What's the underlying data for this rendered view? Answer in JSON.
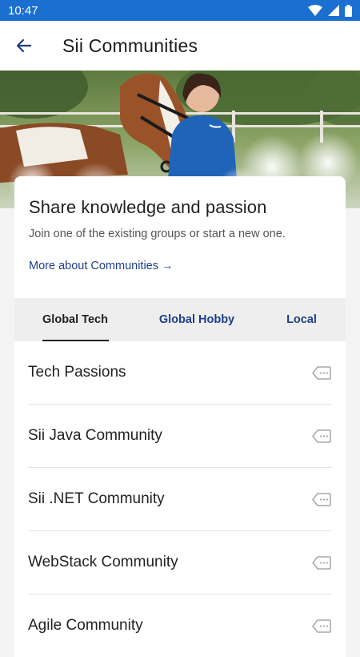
{
  "status_bar": {
    "time": "10:47"
  },
  "app_bar": {
    "title": "Sii Communities"
  },
  "card": {
    "headline": "Share knowledge and passion",
    "subline": "Join one of the existing groups or start a new one.",
    "more_link": "More about Communities →"
  },
  "tabs": [
    {
      "label": "Global Tech",
      "active": true
    },
    {
      "label": "Global Hobby",
      "active": false
    },
    {
      "label": "Local",
      "active": false
    }
  ],
  "communities": [
    {
      "label": "Tech Passions",
      "icon": "tag-icon"
    },
    {
      "label": "Sii Java Community",
      "icon": "tag-icon"
    },
    {
      "label": "Sii .NET Community",
      "icon": "tag-icon"
    },
    {
      "label": "WebStack Community",
      "icon": "tag-icon"
    },
    {
      "label": "Agile Community",
      "icon": "tag-icon"
    }
  ],
  "colors": {
    "status_bar": "#1a6fd1",
    "accent": "#1d3f8a",
    "row_icon": "#a7a7a7"
  },
  "hero_image": {
    "icons": [
      "horse",
      "person"
    ]
  }
}
